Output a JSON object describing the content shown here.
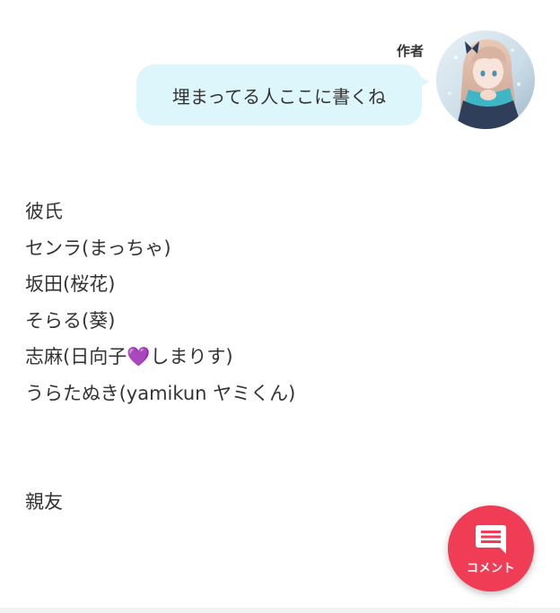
{
  "author": {
    "label": "作者",
    "message": "埋まってる人ここに書くね",
    "avatar_icon": "anime-girl-avatar"
  },
  "body": {
    "lines": [
      "彼氏",
      "センラ(まっちゃ)",
      "坂田(桜花)",
      "そらる(葵)",
      "志麻(日向子💜しまりす)",
      "うらたぬき(yamikun ヤミくん)",
      "",
      "",
      "親友"
    ]
  },
  "fab": {
    "label": "コメント",
    "icon": "comment-icon",
    "color": "#f03c55"
  },
  "colors": {
    "bubble": "#dcf6fb",
    "text": "#333333"
  }
}
